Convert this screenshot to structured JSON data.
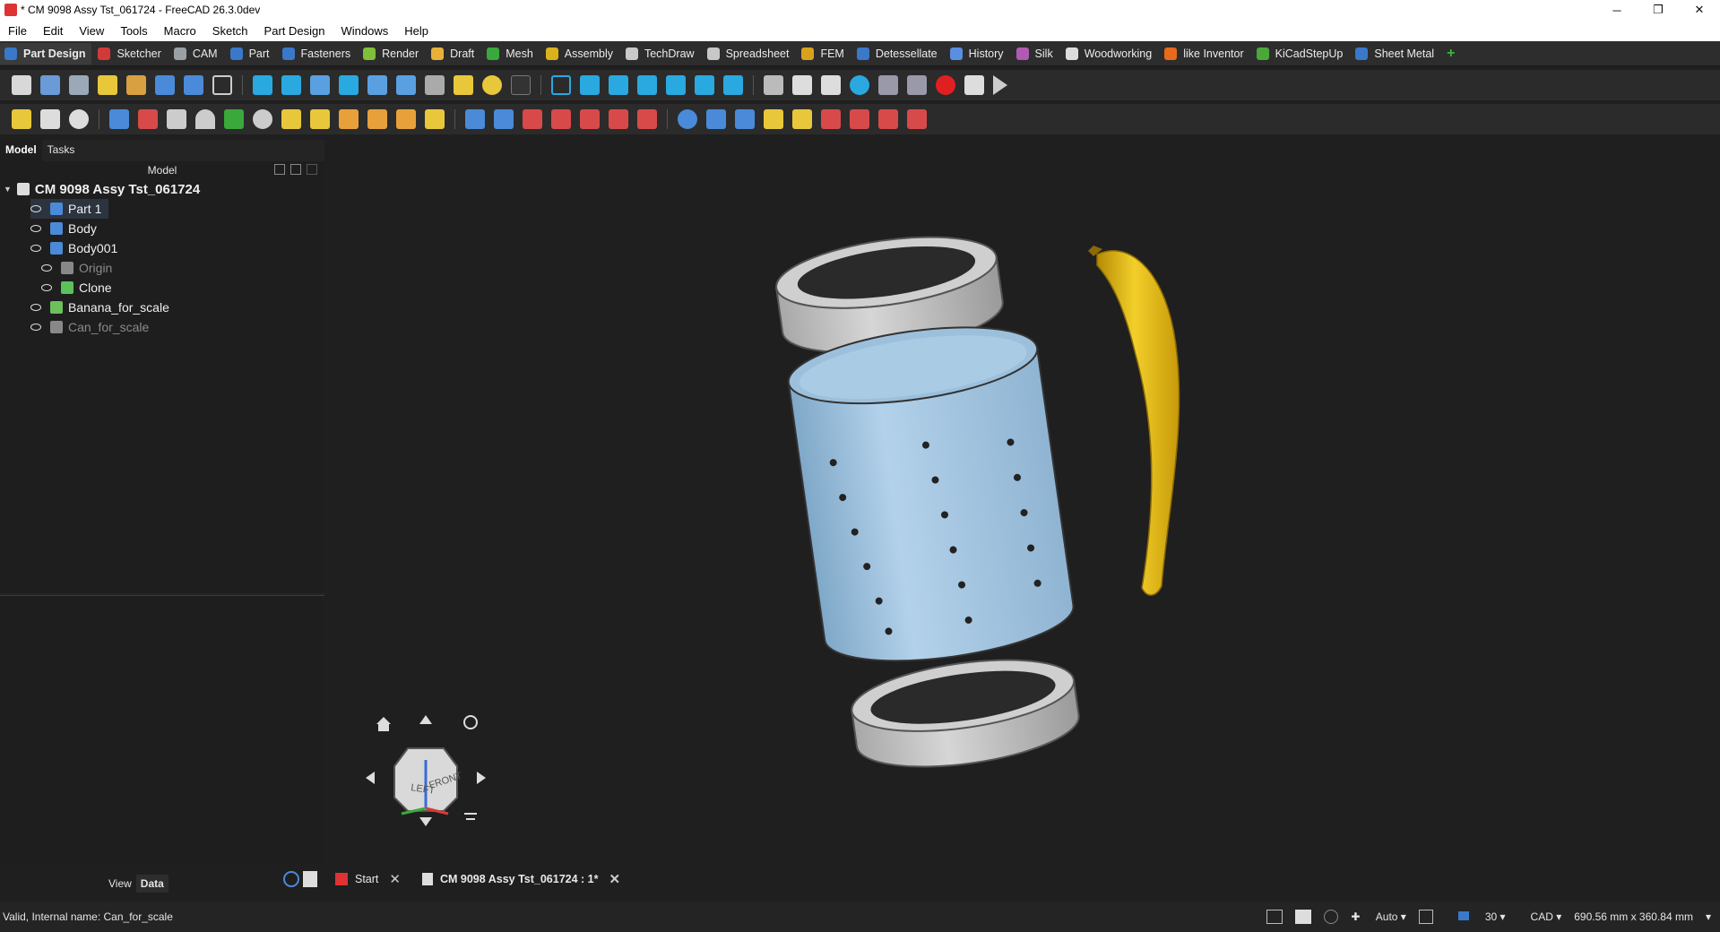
{
  "window": {
    "title": "* CM 9098 Assy Tst_061724 - FreeCAD 26.3.0dev",
    "min": "─",
    "restore": "❐",
    "close": "✕"
  },
  "menu": [
    "File",
    "Edit",
    "View",
    "Tools",
    "Macro",
    "Sketch",
    "Part Design",
    "Windows",
    "Help"
  ],
  "workbenches": [
    {
      "label": "Part Design",
      "color": "#3a78c9"
    },
    {
      "label": "Sketcher",
      "color": "#d23a3a"
    },
    {
      "label": "CAM",
      "color": "#9aa0a6"
    },
    {
      "label": "Part",
      "color": "#3a78c9"
    },
    {
      "label": "Fasteners",
      "color": "#3a78c9"
    },
    {
      "label": "Render",
      "color": "#7fbf3a"
    },
    {
      "label": "Draft",
      "color": "#e8b23a"
    },
    {
      "label": "Mesh",
      "color": "#3aa83a"
    },
    {
      "label": "Assembly",
      "color": "#d9b21c"
    },
    {
      "label": "TechDraw",
      "color": "#c8c8c8"
    },
    {
      "label": "Spreadsheet",
      "color": "#c8c8c8"
    },
    {
      "label": "FEM",
      "color": "#d9a21c"
    },
    {
      "label": "Detessellate",
      "color": "#3a78c9"
    },
    {
      "label": "History",
      "color": "#5a8ee0"
    },
    {
      "label": "Silk",
      "color": "#b05ab5"
    },
    {
      "label": "Woodworking",
      "color": "#dddddd"
    },
    {
      "label": "like Inventor",
      "color": "#e86a1c"
    },
    {
      "label": "KiCadStepUp",
      "color": "#4aa83a"
    },
    {
      "label": "Sheet Metal",
      "color": "#3a78c9"
    }
  ],
  "add_workbench": "+",
  "panel": {
    "tab_model": "Model",
    "tab_tasks": "Tasks",
    "tree_header": "Model",
    "document": "CM 9098 Assy Tst_061724",
    "items": [
      {
        "label": "Part 1",
        "icon": "#4a8ad8",
        "level": 1,
        "dim": false,
        "selected": true
      },
      {
        "label": "Body",
        "icon": "#4a8ad8",
        "level": 1,
        "dim": false,
        "selected": false
      },
      {
        "label": "Body001",
        "icon": "#4a8ad8",
        "level": 1,
        "dim": false,
        "selected": false
      },
      {
        "label": "Origin",
        "icon": "#888888",
        "level": 2,
        "dim": true,
        "selected": false
      },
      {
        "label": "Clone",
        "icon": "#5cc05c",
        "level": 2,
        "dim": false,
        "selected": false
      },
      {
        "label": "Banana_for_scale",
        "icon": "#6cc05c",
        "level": 1,
        "dim": false,
        "selected": false
      },
      {
        "label": "Can_for_scale",
        "icon": "#888888",
        "level": 1,
        "dim": true,
        "selected": false
      }
    ],
    "bottom_tab_view": "View",
    "bottom_tab_data": "Data"
  },
  "doc_tabs": [
    {
      "label": "Start",
      "active": false
    },
    {
      "label": "CM 9098 Assy Tst_061724 : 1*",
      "active": true
    }
  ],
  "navcube": {
    "left": "LEFT",
    "front": "FRONT"
  },
  "status": {
    "message": "Valid, Internal name: Can_for_scale",
    "nav_mode": "Auto",
    "zoom": "30",
    "style": "CAD",
    "dimensions": "690.56 mm x 360.84 mm"
  }
}
